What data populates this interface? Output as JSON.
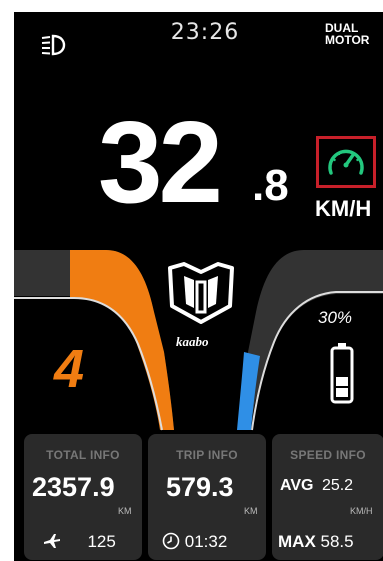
{
  "status_bar": {
    "time": "23:26",
    "motor_line1": "DUAL",
    "motor_line2": "MOTOR",
    "headlight_icon": "headlight-icon"
  },
  "speed": {
    "integer": "32",
    "decimal": ".8",
    "unit": "KM/H",
    "indicator_icon": "speedometer-icon"
  },
  "assist_level": "4",
  "brand": "kaabo",
  "battery": {
    "percent": "30%",
    "level": 0.3
  },
  "cards": {
    "total": {
      "title": "TOTAL INFO",
      "value": "2357.9",
      "unit": "KM",
      "foot_value": "125",
      "foot_icon": "flight-hours-icon"
    },
    "trip": {
      "title": "TRIP INFO",
      "value": "579.3",
      "unit": "KM",
      "foot_value": "01:32",
      "foot_icon": "clock-icon"
    },
    "speed": {
      "title": "SPEED INFO",
      "avg_label": "AVG",
      "avg_value": "25.2",
      "unit": "KM/H",
      "max_label": "MAX",
      "max_value": "58.5"
    }
  },
  "colors": {
    "accent_orange": "#f07d12",
    "accent_blue": "#2f8fe6",
    "indicator_green": "#23c77e",
    "highlight_red": "#c8202a"
  }
}
